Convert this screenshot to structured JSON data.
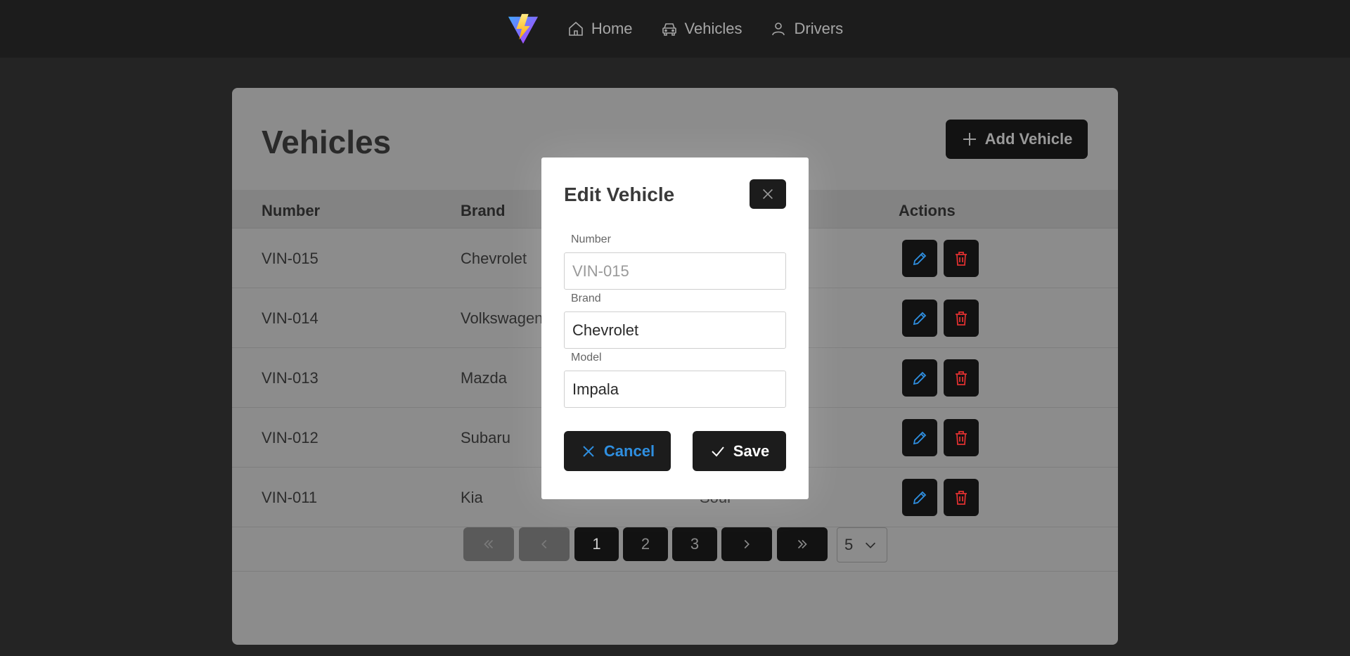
{
  "nav": {
    "logo": "vite-logo",
    "items": [
      {
        "label": "Home",
        "icon": "home-icon"
      },
      {
        "label": "Vehicles",
        "icon": "car-icon"
      },
      {
        "label": "Drivers",
        "icon": "user-icon"
      }
    ]
  },
  "page": {
    "title": "Vehicles",
    "add_button": "Add Vehicle"
  },
  "table": {
    "columns": [
      "Number",
      "Brand",
      "Actions"
    ],
    "rows": [
      {
        "number": "VIN-015",
        "brand": "Chevrolet"
      },
      {
        "number": "VIN-014",
        "brand": "Volkswagen"
      },
      {
        "number": "VIN-013",
        "brand": "Mazda"
      },
      {
        "number": "VIN-012",
        "brand": "Subaru"
      },
      {
        "number": "VIN-011",
        "brand": "Kia",
        "model_partial": "Soul"
      }
    ]
  },
  "pagination": {
    "pages": [
      "1",
      "2",
      "3"
    ],
    "current": "1",
    "page_size": "5"
  },
  "modal": {
    "title": "Edit Vehicle",
    "fields": {
      "number": {
        "label": "Number",
        "value": "VIN-015"
      },
      "brand": {
        "label": "Brand",
        "value": "Chevrolet"
      },
      "model": {
        "label": "Model",
        "value": "Impala"
      }
    },
    "cancel_label": "Cancel",
    "save_label": "Save"
  },
  "colors": {
    "edit_icon": "#2f8fe0",
    "delete_icon": "#e03030",
    "cancel_text": "#2f8fe0",
    "save_text": "#ffffff"
  }
}
